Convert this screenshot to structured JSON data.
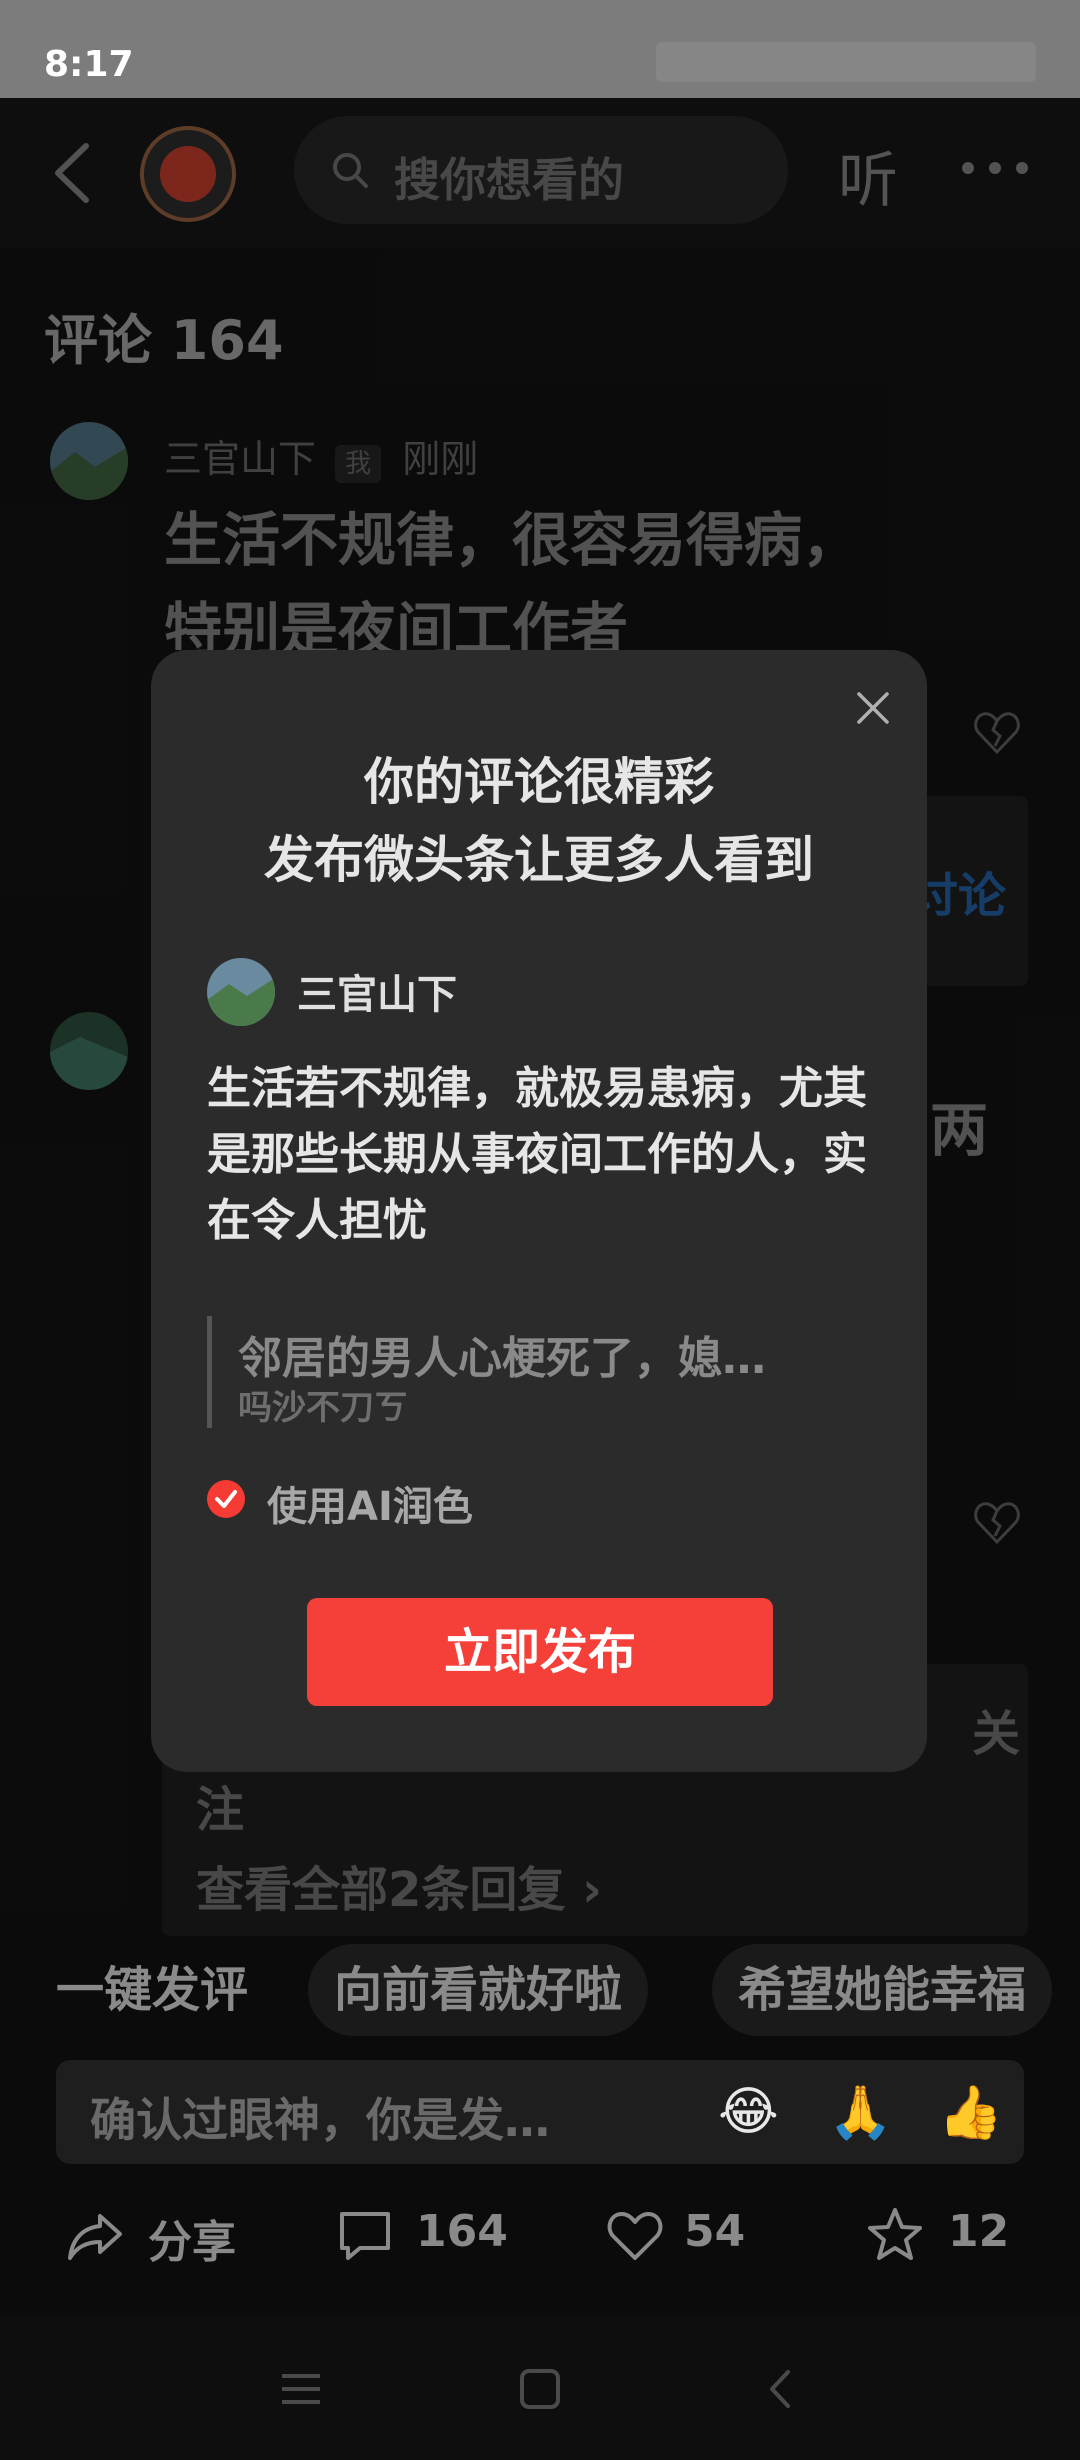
{
  "status_bar": {
    "time": "8:17"
  },
  "header": {
    "search_placeholder": "搜你想看的",
    "listen_label": "听"
  },
  "comments": {
    "title": "评论 164",
    "items": [
      {
        "user": "三官山下",
        "tag": "我",
        "time": "刚刚",
        "text": "生活不规律，很容易得病，",
        "text_cut": "特别是夜间工作者"
      }
    ],
    "partial_right_text": "讨论",
    "partial_right_text2": "两",
    "reply_partial": "注",
    "view_replies": "查看全部2条回复 ›",
    "reply_partial_right": "关"
  },
  "modal": {
    "title_line1": "你的评论很精彩",
    "title_line2": "发布微头条让更多人看到",
    "user": "三官山下",
    "polished_text": "生活若不规律，就极易患病，尤其是那些长期从事夜间工作的人，实在令人担忧",
    "quote_title": "邻居的男人心梗死了，媳…",
    "quote_sub": "吗沙不刀ㄎ",
    "ai_label": "使用AI润色",
    "publish_button": "立即发布"
  },
  "quick_comments": [
    "一键发评",
    "向前看就好啦",
    "希望她能幸福"
  ],
  "comment_input": {
    "placeholder": "确认过眼神，你是发…",
    "emojis": [
      "😂",
      "🙏",
      "👍"
    ]
  },
  "actions": {
    "share_label": "分享",
    "comment_count": "164",
    "like_count": "54",
    "favorite_count": "12"
  }
}
